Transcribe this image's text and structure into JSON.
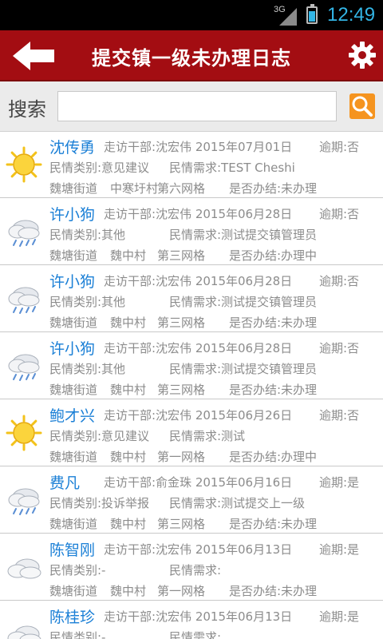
{
  "status_bar": {
    "network": "3G",
    "time": "12:49",
    "battery_level": 0.7
  },
  "header": {
    "title": "提交镇一级未办理日志",
    "back_icon": "back-arrow-icon",
    "settings_icon": "gear-icon"
  },
  "search": {
    "label": "搜索",
    "value": "",
    "placeholder": "",
    "button_icon": "search-icon",
    "accent": "#f5941f"
  },
  "colors": {
    "title_bar": "#a30d12",
    "name": "#1a7fd6",
    "meta": "#8c8c8c"
  },
  "records": [
    {
      "weather_icon": "sun-icon",
      "name": "沈传勇",
      "visitor": "走访干部:沈宏伟 2015年07月01日",
      "overdue": "逾期:否",
      "category": "民情类别:意见建议",
      "request": "民情需求:TEST Cheshi",
      "street": "魏塘街道",
      "village": "中寒圩村",
      "grid": "第六网格",
      "done": "是否办结:未办理"
    },
    {
      "weather_icon": "rain-cloud-icon",
      "name": "许小狗",
      "visitor": "走访干部:沈宏伟 2015年06月28日",
      "overdue": "逾期:否",
      "category": "民情类别:其他",
      "request": "民情需求:测试提交镇管理员",
      "street": "魏塘街道",
      "village": "魏中村",
      "grid": "第三网格",
      "done": "是否办结:办理中"
    },
    {
      "weather_icon": "rain-cloud-icon",
      "name": "许小狗",
      "visitor": "走访干部:沈宏伟 2015年06月28日",
      "overdue": "逾期:否",
      "category": "民情类别:其他",
      "request": "民情需求:测试提交镇管理员",
      "street": "魏塘街道",
      "village": "魏中村",
      "grid": "第三网格",
      "done": "是否办结:未办理"
    },
    {
      "weather_icon": "rain-cloud-icon",
      "name": "许小狗",
      "visitor": "走访干部:沈宏伟 2015年06月28日",
      "overdue": "逾期:否",
      "category": "民情类别:其他",
      "request": "民情需求:测试提交镇管理员",
      "street": "魏塘街道",
      "village": "魏中村",
      "grid": "第三网格",
      "done": "是否办结:未办理"
    },
    {
      "weather_icon": "sun-icon",
      "name": "鲍才兴",
      "visitor": "走访干部:沈宏伟 2015年06月26日",
      "overdue": "逾期:否",
      "category": "民情类别:意见建议",
      "request": "民情需求:测试",
      "street": "魏塘街道",
      "village": "魏中村",
      "grid": "第一网格",
      "done": "是否办结:办理中"
    },
    {
      "weather_icon": "rain-cloud-icon",
      "name": "费凡",
      "visitor": "走访干部:俞金珠 2015年06月16日",
      "overdue": "逾期:是",
      "category": "民情类别:投诉举报",
      "request": "民情需求:测试提交上一级",
      "street": "魏塘街道",
      "village": "魏中村",
      "grid": "第三网格",
      "done": "是否办结:未办理"
    },
    {
      "weather_icon": "cloud-icon",
      "name": "陈智刚",
      "visitor": "走访干部:沈宏伟 2015年06月13日",
      "overdue": "逾期:是",
      "category": "民情类别:-",
      "request": "民情需求:",
      "street": "魏塘街道",
      "village": "魏中村",
      "grid": "第一网格",
      "done": "是否办结:未办理"
    },
    {
      "weather_icon": "cloud-icon",
      "name": "陈桂珍",
      "visitor": "走访干部:沈宏伟 2015年06月13日",
      "overdue": "逾期:是",
      "category": "民情类别:-",
      "request": "民情需求:",
      "street": "",
      "village": "",
      "grid": "",
      "done": ""
    }
  ]
}
